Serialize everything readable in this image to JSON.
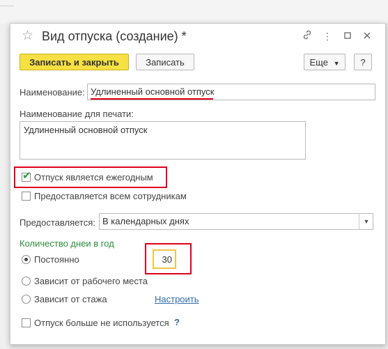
{
  "window": {
    "title": "Вид отпуска (создание) *"
  },
  "toolbar": {
    "save_close_label": "Записать и закрыть",
    "save_label": "Записать",
    "more_label": "Еще",
    "help_label": "?"
  },
  "form": {
    "name_label": "Наименование:",
    "name_value": "Удлиненный основной отпуск",
    "print_name_label": "Наименование для печати:",
    "print_name_value": "Удлиненный основной отпуск",
    "annual_label": "Отпуск является ежегодным",
    "annual_checked": true,
    "all_employees_label": "Предоставляется всем сотрудникам",
    "all_employees_checked": false,
    "provided_label": "Предоставляется:",
    "provided_value": "В календарных днях",
    "days_section_label": "Количество днеи в год",
    "radio_constant_label": "Постоянно",
    "radio_workplace_label": "Зависит от рабочего места",
    "radio_seniority_label": "Зависит от стажа",
    "configure_link": "Настроить",
    "days_value": "30",
    "not_used_label": "Отпуск больше не используется",
    "not_used_help": "?"
  },
  "colors": {
    "accent_yellow": "#f6e043",
    "highlight_red": "#e0001b",
    "section_green": "#2e8b3a",
    "link_blue": "#2f6aa8"
  }
}
